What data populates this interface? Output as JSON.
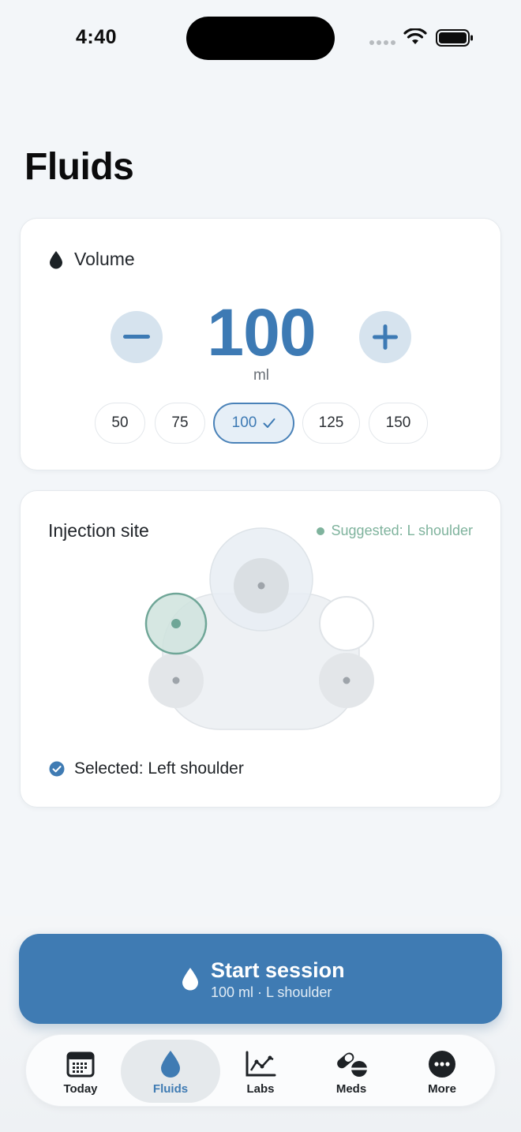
{
  "status_bar": {
    "time": "4:40"
  },
  "page": {
    "title": "Fluids"
  },
  "volume": {
    "title": "Volume",
    "value": "100",
    "unit": "ml",
    "minus_label": "−",
    "plus_label": "+",
    "presets": [
      "50",
      "75",
      "100",
      "125",
      "150"
    ],
    "selected_preset": "100"
  },
  "injection_site": {
    "title": "Injection site",
    "suggested": "Suggested: L shoulder",
    "selected_text": "Selected: Left shoulder",
    "sites": [
      "Left shoulder",
      "Neck/scruff",
      "Right shoulder",
      "Left hip",
      "Right hip"
    ],
    "selected_site": "Left shoulder"
  },
  "start": {
    "title": "Start session",
    "subtitle": "100 ml · L shoulder"
  },
  "tabs": [
    {
      "label": "Today",
      "icon": "calendar-icon"
    },
    {
      "label": "Fluids",
      "icon": "drop-icon",
      "active": true
    },
    {
      "label": "Labs",
      "icon": "chart-icon"
    },
    {
      "label": "Meds",
      "icon": "pills-icon"
    },
    {
      "label": "More",
      "icon": "more-icon"
    }
  ],
  "colors": {
    "accent": "#3f7bb3",
    "suggest": "#7fb39d",
    "background": "#f3f6f9"
  }
}
